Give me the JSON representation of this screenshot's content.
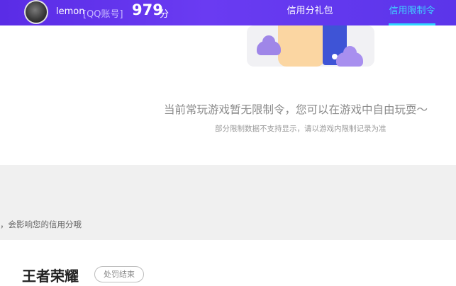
{
  "header": {
    "username": "lemon",
    "account_type": "[QQ账号]",
    "score": "979",
    "score_unit": "分",
    "nav": [
      {
        "label": "信用分礼包",
        "active": false
      },
      {
        "label": "信用限制令",
        "active": true
      }
    ],
    "colors": {
      "bar": "#5a2ce6",
      "active_tab": "#3fd3ff"
    }
  },
  "empty_state": {
    "illustration": "hand-with-phone-illustration",
    "title": "当前常玩游戏暂无限制令，您可以在游戏中自由玩耍～",
    "note": "部分限制数据不支持显示，请以游戏内限制记录为准"
  },
  "notice": {
    "text": "，会影响您的信用分哦"
  },
  "game": {
    "name": "王者荣耀",
    "status": "处罚结束"
  }
}
